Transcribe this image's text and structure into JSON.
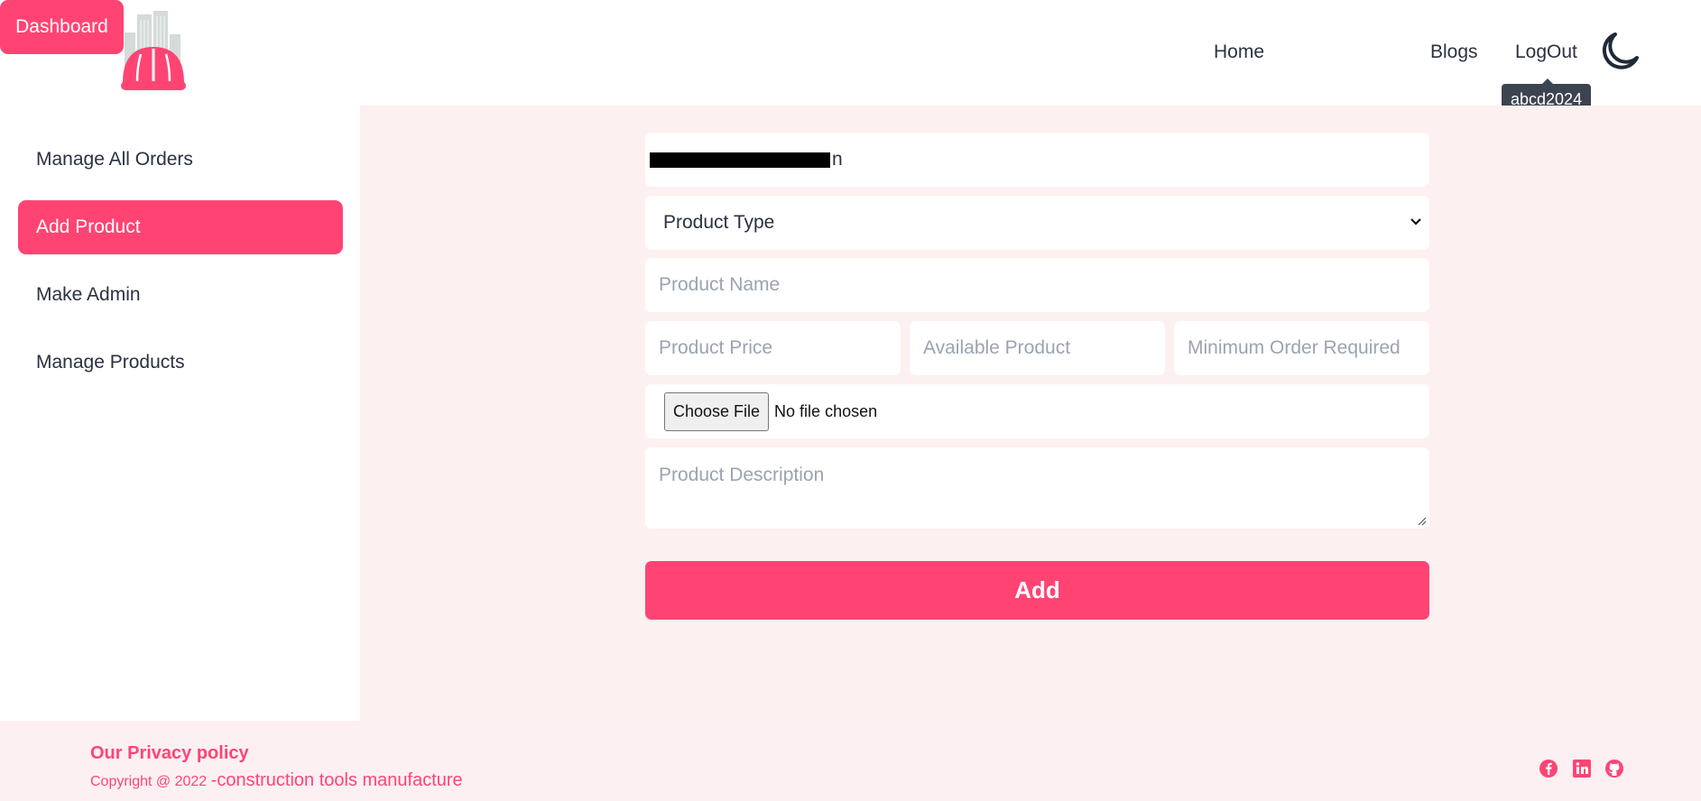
{
  "header": {
    "nav": {
      "home": "Home",
      "dashboard": "Dashboard",
      "blogs": "Blogs",
      "logout": "LogOut"
    },
    "user_tooltip": "abcd2024",
    "theme_icon": "moon-icon"
  },
  "sidebar": {
    "items": [
      {
        "label": "Manage All Orders",
        "active": false
      },
      {
        "label": "Add Product",
        "active": true
      },
      {
        "label": "Make Admin",
        "active": false
      },
      {
        "label": "Manage Products",
        "active": false
      }
    ]
  },
  "form": {
    "email_visible_tail": "n",
    "product_type": "Product Type",
    "product_name_placeholder": "Product Name",
    "product_price_placeholder": "Product Price",
    "available_product_placeholder": "Available Product",
    "minimum_order_placeholder": "Minimum Order Required",
    "file_button": "Choose File",
    "file_status": "No file chosen",
    "description_placeholder": "Product Description",
    "submit_label": "Add"
  },
  "footer": {
    "privacy": "Our Privacy policy",
    "copyright_prefix": "Copyright @ 2022 ",
    "copyright_brand": "-construction tools manufacture",
    "social_icons": [
      "facebook-icon",
      "linkedin-icon",
      "github-icon"
    ]
  },
  "colors": {
    "accent": "#ff4474",
    "main_bg": "#fdf0f1",
    "text": "#2a3140",
    "placeholder": "#9ca3af"
  }
}
